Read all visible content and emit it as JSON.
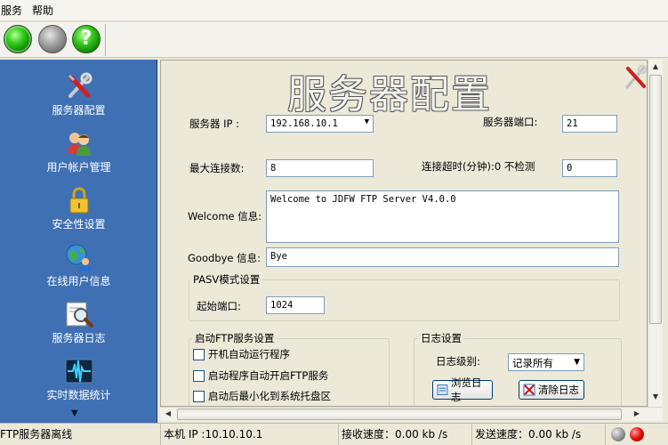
{
  "menu": {
    "items": [
      "服务",
      "帮助"
    ]
  },
  "toolbar": {
    "start_icon": "green-light-icon",
    "stop_icon": "gray-light-icon",
    "help_label": "?"
  },
  "sidebar": {
    "items": [
      {
        "label": "服务器配置",
        "icon": "tools-icon"
      },
      {
        "label": "用户帐户管理",
        "icon": "users-icon"
      },
      {
        "label": "安全性设置",
        "icon": "lock-icon"
      },
      {
        "label": "在线用户信息",
        "icon": "globe-users-icon"
      },
      {
        "label": "服务器日志",
        "icon": "magnifier-icon"
      },
      {
        "label": "实时数据统计",
        "icon": "pulse-icon"
      }
    ],
    "scroll_arrow": "▼"
  },
  "main": {
    "title": "服务器配置",
    "server_ip_label": "服务器 IP :",
    "server_ip_value": "192.168.10.1",
    "server_port_label": "服务器端口:",
    "server_port_value": "21",
    "max_conn_label": "最大连接数:",
    "max_conn_value": "8",
    "timeout_label": "连接超时(分钟):0 不检测",
    "timeout_value": "0",
    "welcome_label": "Welcome 信息:",
    "welcome_value": "Welcome to JDFW  FTP Server V4.0.0",
    "goodbye_label": "Goodbye 信息:",
    "goodbye_value": "Bye",
    "pasv_group_title": "PASV模式设置",
    "start_port_label": "起始端口:",
    "start_port_value": "1024",
    "startup_group_title": "启动FTP服务设置",
    "startup_options": [
      "开机自动运行程序",
      "启动程序自动开启FTP服务",
      "启动后最小化到系统托盘区"
    ],
    "log_group_title": "日志设置",
    "log_level_label": "日志级别:",
    "log_level_value": "记录所有",
    "browse_log_label": "浏览日志",
    "clear_log_label": "清除日志"
  },
  "statusbar": {
    "server_status": "FTP服务器离线",
    "local_ip": "本机 IP :10.10.10.1",
    "recv_speed": "接收速度：0.00   kb /s",
    "send_speed": "发送速度：0.00   kb /s"
  },
  "colors": {
    "sidebar_bg": "#3f70b4",
    "status_gray": "#8a8a8a",
    "status_red": "#e00000"
  }
}
